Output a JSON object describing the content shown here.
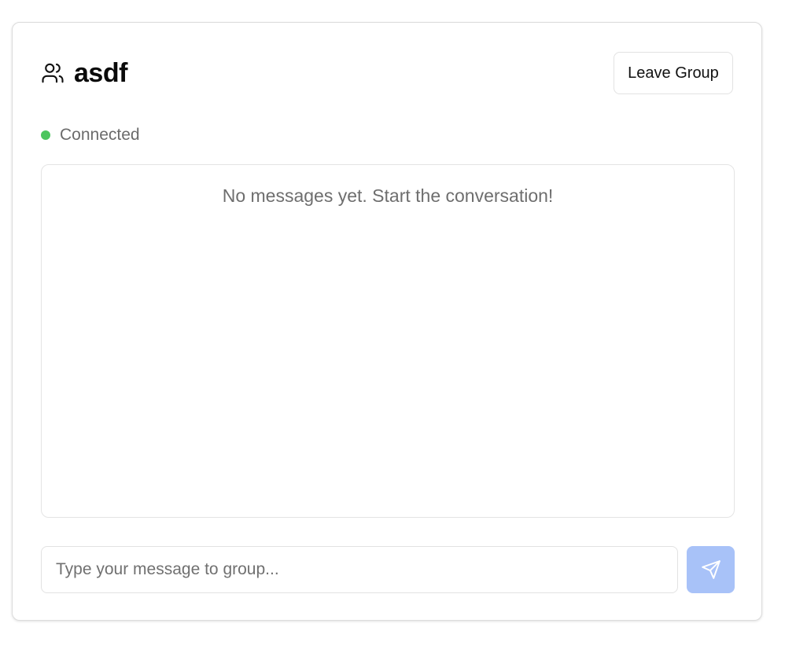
{
  "group": {
    "name": "asdf",
    "icon": "users-icon"
  },
  "actions": {
    "leave_label": "Leave Group"
  },
  "status": {
    "label": "Connected",
    "color": "#4cc55e"
  },
  "messages": {
    "empty_text": "No messages yet. Start the conversation!",
    "items": []
  },
  "composer": {
    "placeholder": "Type your message to group...",
    "value": "",
    "send_icon": "send-icon",
    "send_button_color": "#a8c2f8"
  }
}
